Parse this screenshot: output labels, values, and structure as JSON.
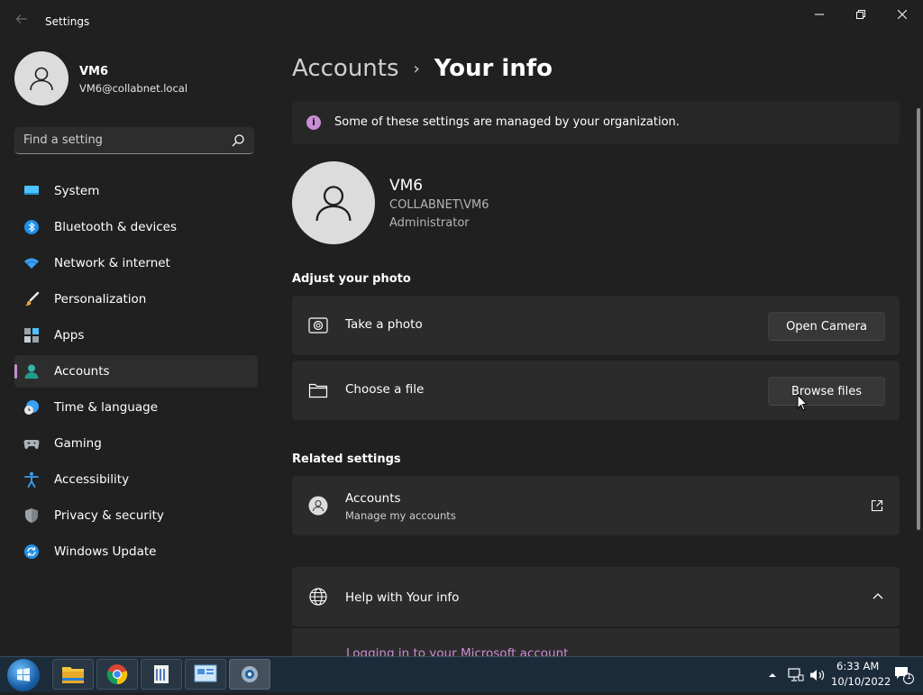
{
  "window": {
    "title": "Settings"
  },
  "profile": {
    "name": "VM6",
    "email": "VM6@collabnet.local"
  },
  "search": {
    "placeholder": "Find a setting"
  },
  "nav": {
    "items": [
      {
        "label": "System",
        "icon": "monitor-icon"
      },
      {
        "label": "Bluetooth & devices",
        "icon": "bluetooth-icon"
      },
      {
        "label": "Network & internet",
        "icon": "wifi-icon"
      },
      {
        "label": "Personalization",
        "icon": "brush-icon"
      },
      {
        "label": "Apps",
        "icon": "apps-icon"
      },
      {
        "label": "Accounts",
        "icon": "person-icon",
        "active": true
      },
      {
        "label": "Time & language",
        "icon": "clock-globe-icon"
      },
      {
        "label": "Gaming",
        "icon": "gamepad-icon"
      },
      {
        "label": "Accessibility",
        "icon": "accessibility-icon"
      },
      {
        "label": "Privacy & security",
        "icon": "shield-icon"
      },
      {
        "label": "Windows Update",
        "icon": "update-icon"
      }
    ]
  },
  "breadcrumb": {
    "parent": "Accounts",
    "separator": "›",
    "current": "Your info"
  },
  "banner": {
    "text": "Some of these settings are managed by your organization."
  },
  "user": {
    "name": "VM6",
    "domain": "COLLABNET\\VM6",
    "role": "Administrator"
  },
  "adjust_photo": {
    "title": "Adjust your photo",
    "take_photo": {
      "label": "Take a photo",
      "button": "Open Camera"
    },
    "choose_file": {
      "label": "Choose a file",
      "button": "Browse files"
    }
  },
  "related": {
    "title": "Related settings",
    "accounts": {
      "label": "Accounts",
      "sub": "Manage my accounts"
    }
  },
  "help": {
    "label": "Help with Your info",
    "link": "Logging in to your Microsoft account"
  },
  "taskbar": {
    "apps": [
      "file-explorer-icon",
      "chrome-icon",
      "notepad-icon",
      "control-panel-icon",
      "settings-icon"
    ],
    "time": "6:33 AM",
    "date": "10/10/2022",
    "notifications": "1"
  },
  "colors": {
    "accent": "#c88dd3",
    "background": "#202020",
    "card": "#2b2b2b"
  }
}
